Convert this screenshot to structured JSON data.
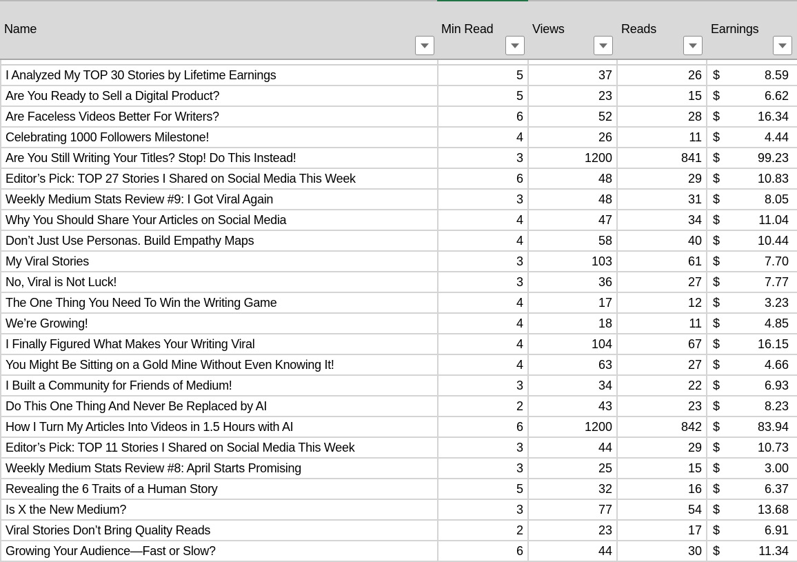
{
  "colors": {
    "header_bg": "#d9d9d9",
    "selection_accent": "#217346",
    "gridline": "#d4d4d4"
  },
  "columns": [
    {
      "key": "name",
      "label": "Name",
      "filter_icon": "filter-dropdown-icon"
    },
    {
      "key": "min_read",
      "label": "Min Read",
      "filter_icon": "filter-dropdown-icon"
    },
    {
      "key": "views",
      "label": "Views",
      "filter_icon": "filter-dropdown-icon"
    },
    {
      "key": "reads",
      "label": "Reads",
      "filter_icon": "filter-dropdown-icon"
    },
    {
      "key": "earnings",
      "label": "Earnings",
      "filter_icon": "filter-dropdown-icon"
    }
  ],
  "currency_symbol": "$",
  "rows": [
    {
      "name": "I Analyzed My TOP 30 Stories by Lifetime Earnings",
      "min_read": "5",
      "views": "37",
      "reads": "26",
      "earnings": "8.59"
    },
    {
      "name": "Are You Ready to Sell a Digital Product?",
      "min_read": "5",
      "views": "23",
      "reads": "15",
      "earnings": "6.62"
    },
    {
      "name": "Are Faceless Videos Better For Writers?",
      "min_read": "6",
      "views": "52",
      "reads": "28",
      "earnings": "16.34"
    },
    {
      "name": "Celebrating 1000 Followers Milestone!",
      "min_read": "4",
      "views": "26",
      "reads": "11",
      "earnings": "4.44"
    },
    {
      "name": "Are You Still Writing Your Titles? Stop! Do This Instead!",
      "min_read": "3",
      "views": "1200",
      "reads": "841",
      "earnings": "99.23"
    },
    {
      "name": "Editor’s Pick: TOP 27 Stories I Shared on Social Media This Week",
      "min_read": "6",
      "views": "48",
      "reads": "29",
      "earnings": "10.83"
    },
    {
      "name": "Weekly Medium Stats Review #9: I Got Viral Again",
      "min_read": "3",
      "views": "48",
      "reads": "31",
      "earnings": "8.05"
    },
    {
      "name": "Why You Should Share Your Articles on Social Media",
      "min_read": "4",
      "views": "47",
      "reads": "34",
      "earnings": "11.04"
    },
    {
      "name": "Don’t Just Use Personas. Build Empathy Maps",
      "min_read": "4",
      "views": "58",
      "reads": "40",
      "earnings": "10.44"
    },
    {
      "name": "My Viral Stories",
      "min_read": "3",
      "views": "103",
      "reads": "61",
      "earnings": "7.70"
    },
    {
      "name": "No, Viral is Not Luck!",
      "min_read": "3",
      "views": "36",
      "reads": "27",
      "earnings": "7.77"
    },
    {
      "name": "The One Thing You Need To Win the Writing Game",
      "min_read": "4",
      "views": "17",
      "reads": "12",
      "earnings": "3.23"
    },
    {
      "name": "We’re Growing!",
      "min_read": "4",
      "views": "18",
      "reads": "11",
      "earnings": "4.85"
    },
    {
      "name": "I Finally Figured What Makes Your Writing Viral",
      "min_read": "4",
      "views": "104",
      "reads": "67",
      "earnings": "16.15"
    },
    {
      "name": "You Might Be Sitting on a Gold Mine Without Even Knowing It!",
      "min_read": "4",
      "views": "63",
      "reads": "27",
      "earnings": "4.66"
    },
    {
      "name": "I Built a Community for Friends of Medium!",
      "min_read": "3",
      "views": "34",
      "reads": "22",
      "earnings": "6.93"
    },
    {
      "name": "Do This One Thing And Never Be Replaced by AI",
      "min_read": "2",
      "views": "43",
      "reads": "23",
      "earnings": "8.23"
    },
    {
      "name": "How I Turn My Articles Into Videos in 1.5 Hours with AI",
      "min_read": "6",
      "views": "1200",
      "reads": "842",
      "earnings": "83.94"
    },
    {
      "name": "Editor’s Pick: TOP 11 Stories I Shared on Social Media This Week",
      "min_read": "3",
      "views": "44",
      "reads": "29",
      "earnings": "10.73"
    },
    {
      "name": "Weekly Medium Stats Review #8: April Starts Promising",
      "min_read": "3",
      "views": "25",
      "reads": "15",
      "earnings": "3.00"
    },
    {
      "name": "Revealing the 6 Traits of a Human Story",
      "min_read": "5",
      "views": "32",
      "reads": "16",
      "earnings": "6.37"
    },
    {
      "name": "Is X the New Medium?",
      "min_read": "3",
      "views": "77",
      "reads": "54",
      "earnings": "13.68"
    },
    {
      "name": "Viral Stories Don’t Bring Quality Reads",
      "min_read": "2",
      "views": "23",
      "reads": "17",
      "earnings": "6.91"
    },
    {
      "name": "Growing Your Audience—Fast or Slow?",
      "min_read": "6",
      "views": "44",
      "reads": "30",
      "earnings": "11.34"
    }
  ]
}
